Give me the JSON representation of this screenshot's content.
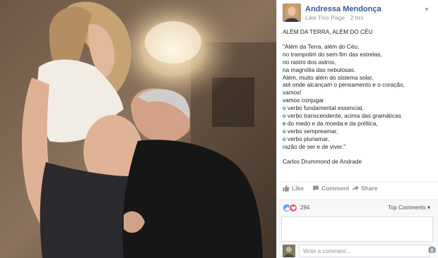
{
  "photo": {
    "alt_icon": "photo-couple-kiss-belly"
  },
  "post": {
    "author": "Andressa Mendonça",
    "like_page": "Like This Page",
    "separator": "·",
    "time": "2 hrs",
    "title": "ALÉM DA TERRA, ALÉM DO CÉU",
    "poem": [
      "\"Além da Terra, além do Céu,",
      "no trampolim do sem-fim das estrelas,",
      "no rastro dos astros,",
      "na magnólia das nebulosas.",
      "Além, muito além do sistema solar,",
      "até onde alcançam o pensamento e o coração,",
      "vamos!",
      "vamos conjugar",
      "o verbo fundamental essencial,",
      "o verbo transcendente, acima das gramáticas",
      "e do medo e da moeda e da política,",
      "o verbo sempreamar,",
      "o verbo pluriamar,",
      "razão de ser e de viver.\""
    ],
    "signature": "Carlos Drummond de Andrade"
  },
  "actions": {
    "like": "Like",
    "comment": "Comment",
    "share": "Share"
  },
  "reactions": {
    "count": "294",
    "top_comments": "Top Comments ▾"
  },
  "composer": {
    "placeholder": "Write a comment..."
  },
  "colors": {
    "link": "#365899",
    "like_blue": "#5890ff",
    "love_red": "#f25268",
    "text": "#1d2129",
    "muted": "#90949c"
  }
}
